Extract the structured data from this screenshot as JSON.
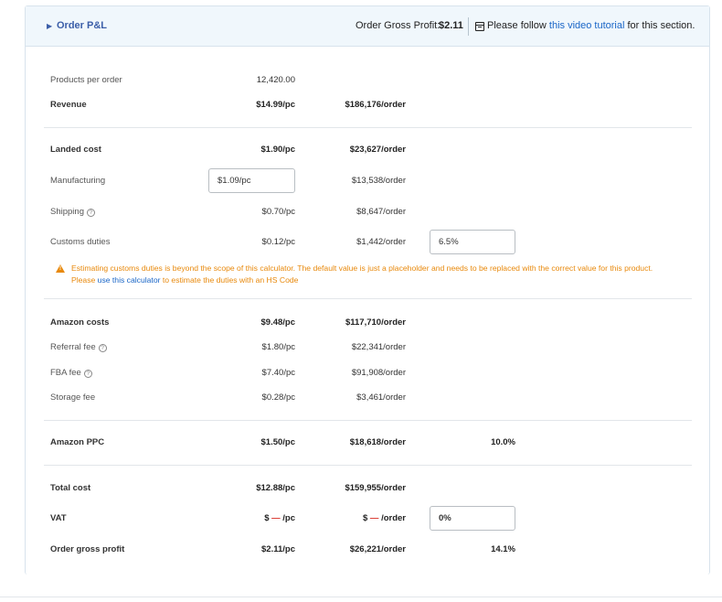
{
  "header": {
    "title": "Order P&L",
    "gross_profit_label": "Order Gross Profit:",
    "gross_profit_value": "$2.11",
    "tutorial_prefix": "Please follow",
    "tutorial_link": "this video tutorial",
    "tutorial_suffix": "for this section."
  },
  "rows": {
    "products_per_order": {
      "label": "Products per order",
      "value": "12,420.00"
    },
    "revenue": {
      "label": "Revenue",
      "per_pc": "$14.99/pc",
      "per_order": "$186,176/order"
    },
    "landed_cost": {
      "label": "Landed cost",
      "per_pc": "$1.90/pc",
      "per_order": "$23,627/order"
    },
    "manufacturing": {
      "label": "Manufacturing",
      "input_value": "$1.09/pc",
      "per_order": "$13,538/order"
    },
    "shipping": {
      "label": "Shipping",
      "per_pc": "$0.70/pc",
      "per_order": "$8,647/order"
    },
    "customs": {
      "label": "Customs duties",
      "per_pc": "$0.12/pc",
      "per_order": "$1,442/order",
      "rate_input": "6.5%"
    },
    "amazon_costs": {
      "label": "Amazon costs",
      "per_pc": "$9.48/pc",
      "per_order": "$117,710/order"
    },
    "referral_fee": {
      "label": "Referral fee",
      "per_pc": "$1.80/pc",
      "per_order": "$22,341/order"
    },
    "fba_fee": {
      "label": "FBA fee",
      "per_pc": "$7.40/pc",
      "per_order": "$91,908/order"
    },
    "storage_fee": {
      "label": "Storage fee",
      "per_pc": "$0.28/pc",
      "per_order": "$3,461/order"
    },
    "amazon_ppc": {
      "label": "Amazon PPC",
      "per_pc": "$1.50/pc",
      "per_order": "$18,618/order",
      "percent": "10.0%"
    },
    "total_cost": {
      "label": "Total cost",
      "per_pc": "$12.88/pc",
      "per_order": "$159,955/order"
    },
    "vat": {
      "label": "VAT",
      "pc_prefix": "$",
      "pc_dash": "—",
      "pc_suffix": "/pc",
      "order_prefix": "$",
      "order_dash": "—",
      "order_suffix": "/order",
      "rate_input": "0%"
    },
    "gross_profit": {
      "label": "Order gross profit",
      "per_pc": "$2.11/pc",
      "per_order": "$26,221/order",
      "percent": "14.1%"
    }
  },
  "warning": {
    "line1": "Estimating customs duties is beyond the scope of this calculator. The default value is just a placeholder and needs to be replaced with the correct value for this product.",
    "line2_prefix": "Please",
    "line2_link": "use this calculator",
    "line2_suffix": "to estimate the duties with an HS Code"
  },
  "icons": {
    "help": "question-circle-icon",
    "warning": "warning-triangle-icon",
    "video": "video-icon",
    "expand": "caret-right-icon"
  },
  "colors": {
    "link": "#1a66c7",
    "warning": "#e8890c",
    "header_bg": "#f0f7fc",
    "header_title": "#3b5ea8",
    "dash": "#d9342b"
  }
}
